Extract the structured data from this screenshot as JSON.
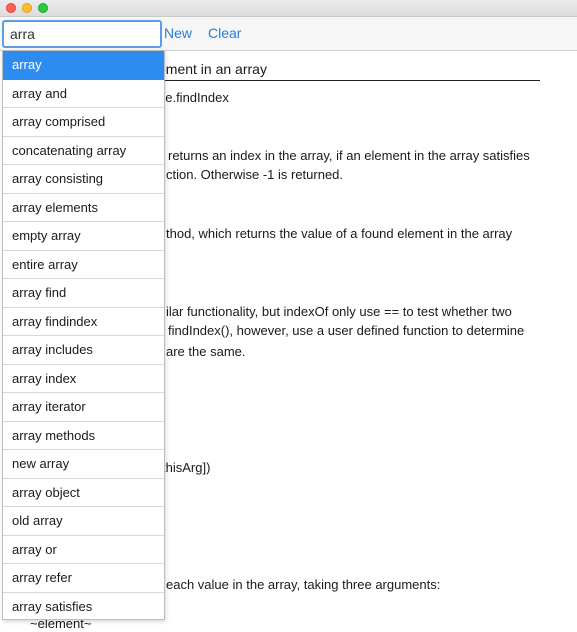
{
  "toolbar": {
    "search_value": "arra",
    "new_label": "New",
    "clear_label": "Clear"
  },
  "document": {
    "heading": "ement in an array",
    "lines": [
      "pe.findIndex",
      "returns an index in the array, if an element in the array satisfies",
      "ction. Otherwise -1 is returned.",
      "thod, which returns the value of a found element in the array",
      "ilar functionality, but indexOf only use == to test whether two",
      "findIndex(), however, use a user defined function to determine",
      "are the same.",
      "thisArg])",
      "each value in the array, taking three arguments:",
      "~element~"
    ]
  },
  "suggestions": {
    "selected_index": 0,
    "items": [
      "array",
      "array and",
      "array comprised",
      "concatenating array",
      "array consisting",
      "array elements",
      "empty array",
      "entire array",
      "array find",
      "array findindex",
      "array includes",
      "array index",
      "array iterator",
      "array methods",
      "new array",
      "array object",
      "old array",
      "array or",
      "array refer",
      "array satisfies"
    ]
  },
  "colors": {
    "accent": "#2d8cf0",
    "link": "#2a7fd0"
  }
}
